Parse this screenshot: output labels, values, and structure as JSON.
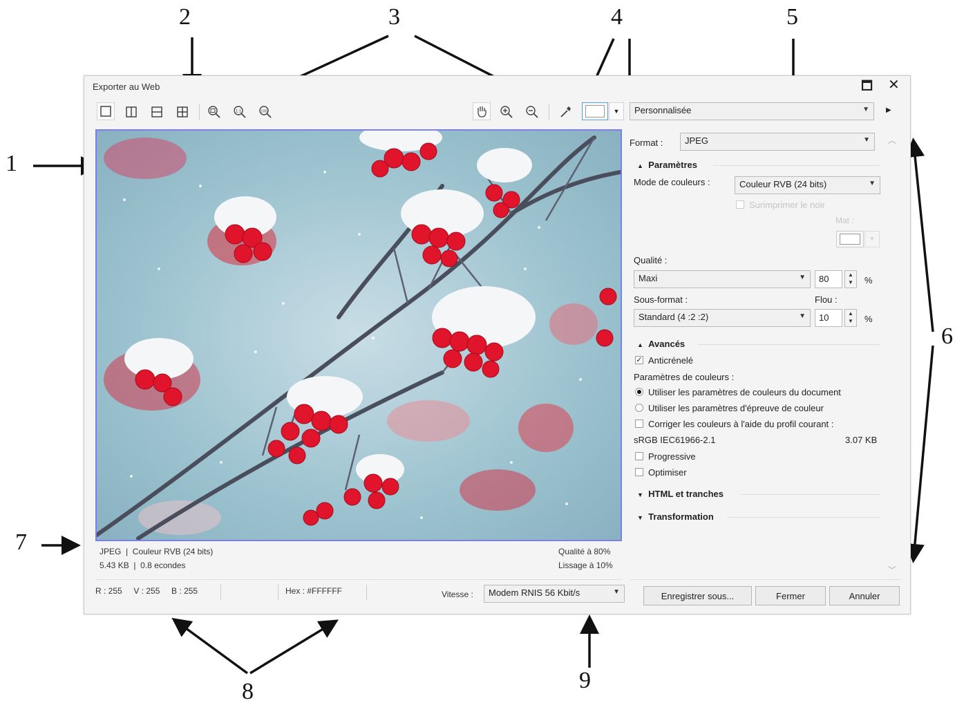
{
  "callouts": [
    "1",
    "2",
    "3",
    "4",
    "5",
    "6",
    "7",
    "8",
    "9"
  ],
  "dialog": {
    "title": "Exporter au Web",
    "maximize": "🗖",
    "close": "✕"
  },
  "toolbar": {
    "preset": "Personnalisée",
    "zoom_labels": [
      "1:1",
      "100"
    ]
  },
  "preview": {
    "format_info": "JPEG  |  Couleur RVB (24 bits)",
    "size_info": "5.43 KB  |  0.8 econdes",
    "quality_info": "Qualité à 80%",
    "smoothing_info": "Lissage à 10%"
  },
  "panel": {
    "format_label": "Format :",
    "format_value": "JPEG",
    "section_params": "Paramètres",
    "color_mode_label": "Mode de couleurs :",
    "color_mode_value": "Couleur RVB (24 bits)",
    "overprint_label": "Surimprimer le noir",
    "matte_label": "Mat :",
    "quality_label": "Qualité :",
    "quality_value": "Maxi",
    "quality_number": "80",
    "percent": "%",
    "subformat_label": "Sous-format :",
    "blur_label": "Flou :",
    "subformat_value": "Standard (4 :2 :2)",
    "blur_number": "10",
    "section_advanced": "Avancés",
    "antialias_label": "Anticrénelé",
    "color_settings_label": "Paramètres de couleurs :",
    "radio_doc": "Utiliser les paramètres de couleurs du document",
    "radio_proof": "Utiliser les paramètres d'épreuve de couleur",
    "correct_label": "Corriger les couleurs à l'aide du profil courant :",
    "profile": "sRGB IEC61966-2.1",
    "filesize": "3.07 KB",
    "progressive_label": "Progressive",
    "optimize_label": "Optimiser",
    "section_html": "HTML et tranches",
    "section_transform": "Transformation"
  },
  "statusbar": {
    "rgb": "R : 255     V : 255     B : 255",
    "hex": "Hex : #FFFFFF",
    "speed_label": "Vitesse :",
    "speed_value": "Modem RNIS 56 Kbit/s"
  },
  "buttons": {
    "save_as": "Enregistrer sous...",
    "close": "Fermer",
    "cancel": "Annuler"
  },
  "colors": {
    "preview_border": "#7b7ff0",
    "berry_red": "#e0142a"
  }
}
